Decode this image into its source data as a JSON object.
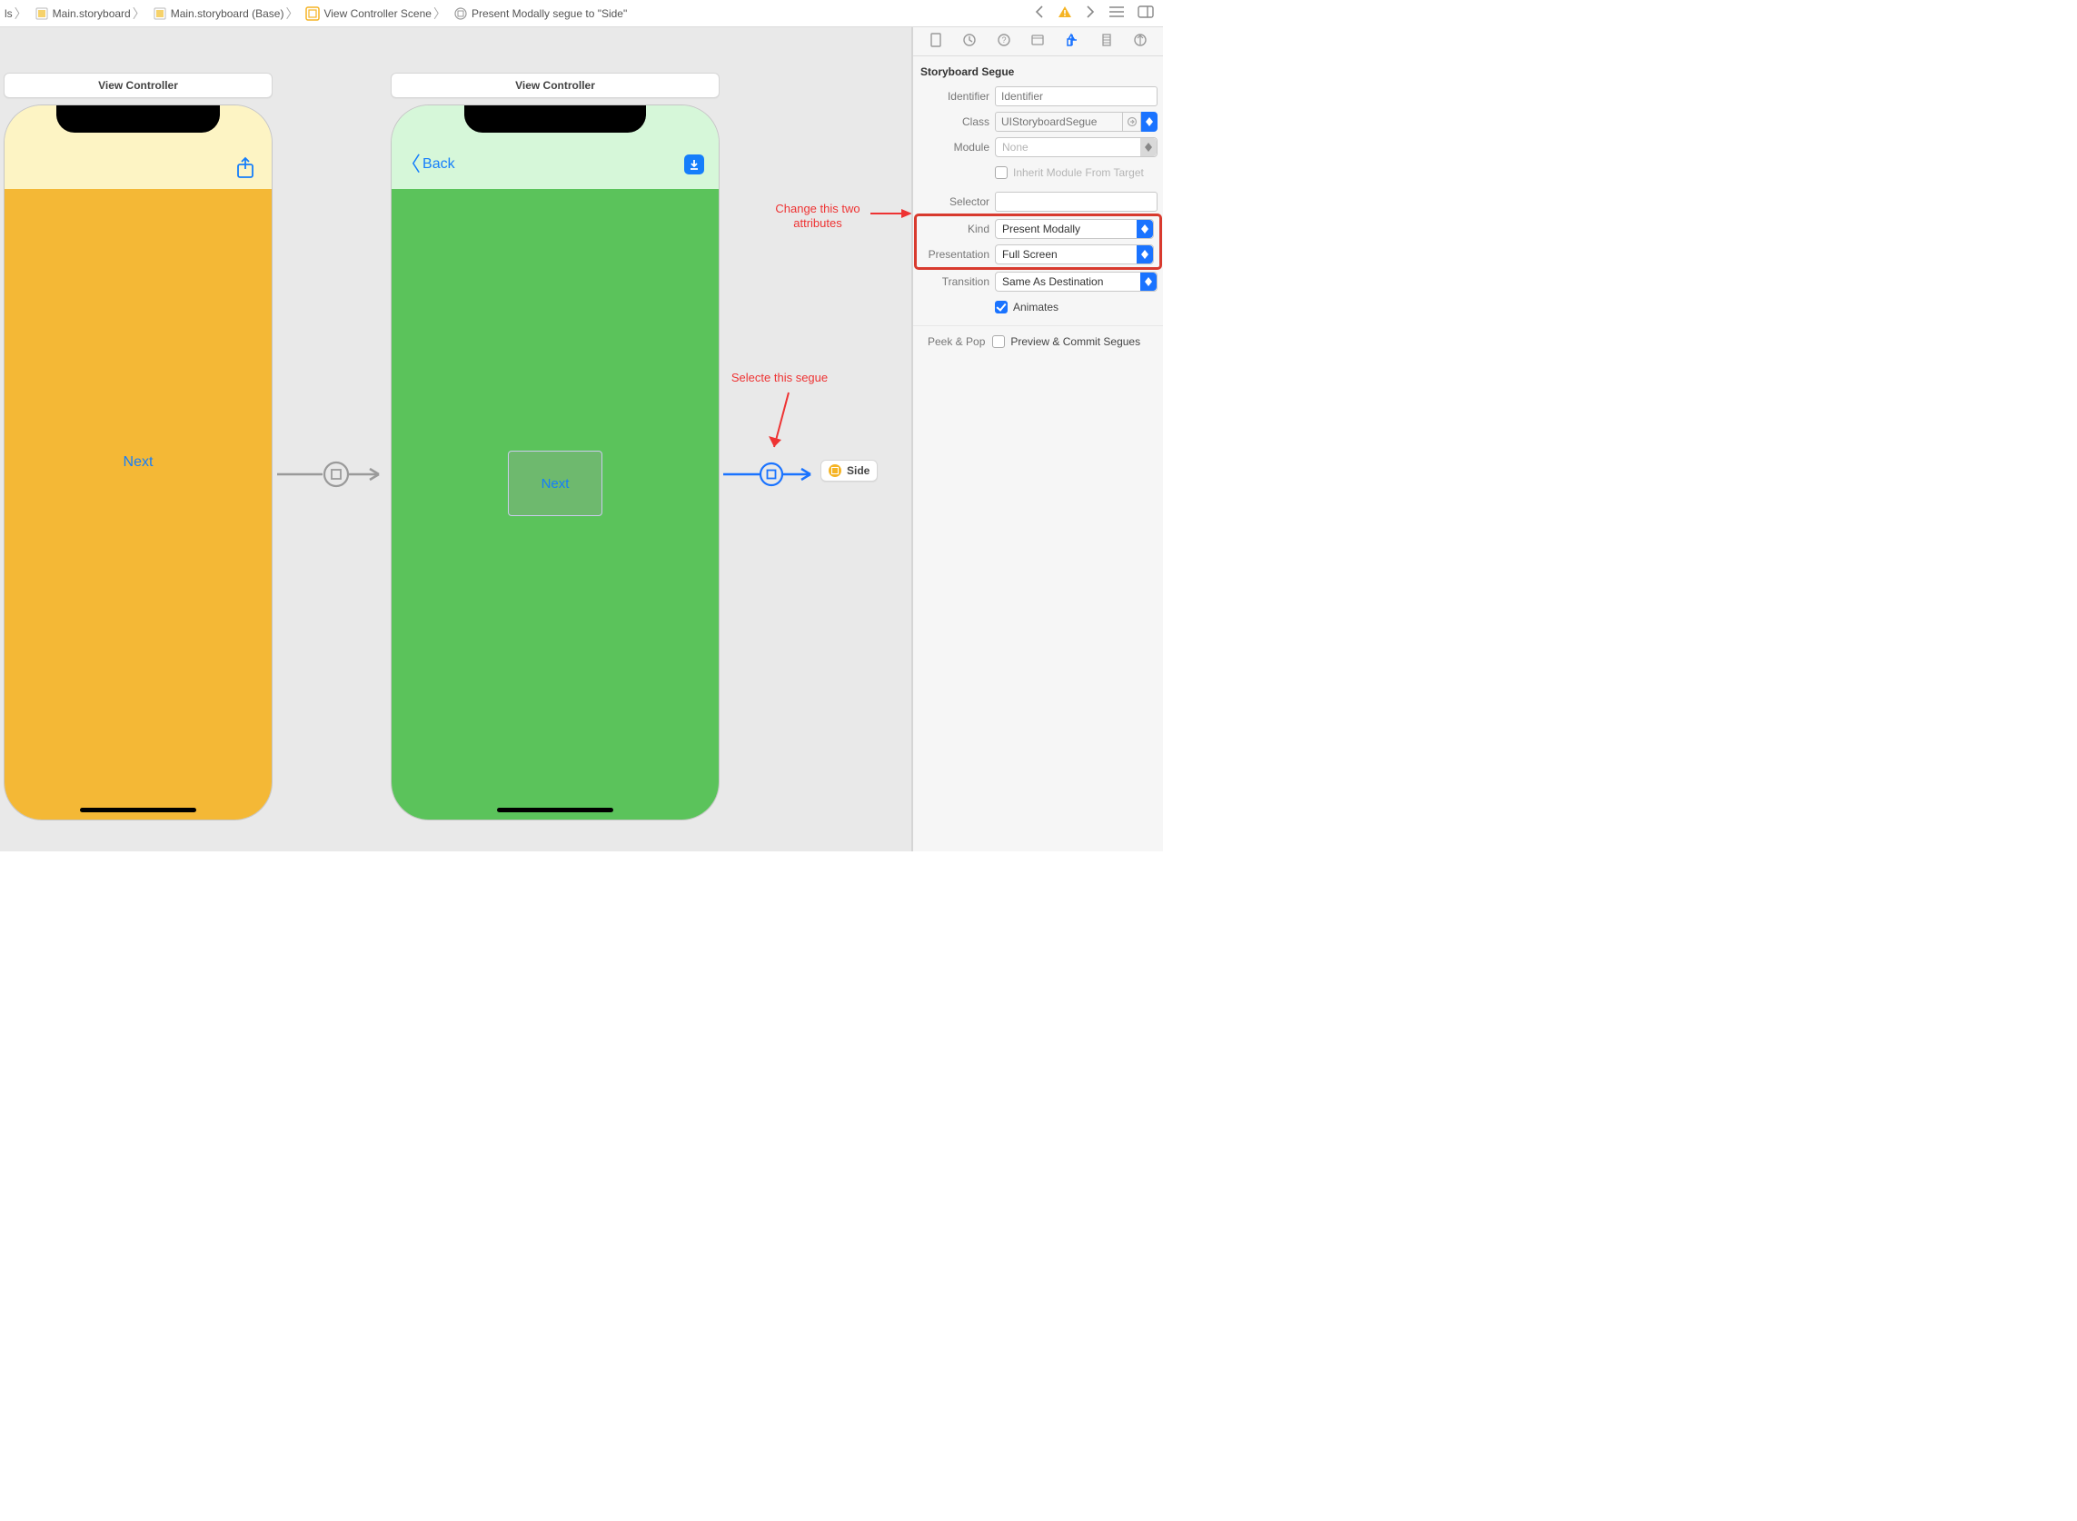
{
  "breadcrumb": {
    "partial": "ls",
    "file": "Main.storyboard",
    "base": "Main.storyboard (Base)",
    "scene": "View Controller Scene",
    "segue": "Present Modally segue to \"Side\""
  },
  "canvas": {
    "vc1": {
      "title": "View Controller",
      "next_label": "Next"
    },
    "vc2": {
      "title": "View Controller",
      "back_label": "Back",
      "next_label": "Next"
    },
    "side_scene_label": "Side"
  },
  "annotations": {
    "select_segue": "Selecte this segue",
    "change_two_1": "Change this two",
    "change_two_2": "attributes"
  },
  "inspector": {
    "section_title": "Storyboard Segue",
    "identifier_label": "Identifier",
    "identifier_placeholder": "Identifier",
    "class_label": "Class",
    "class_placeholder": "UIStoryboardSegue",
    "module_label": "Module",
    "module_value": "None",
    "inherit_label": "Inherit Module From Target",
    "selector_label": "Selector",
    "kind_label": "Kind",
    "kind_value": "Present Modally",
    "presentation_label": "Presentation",
    "presentation_value": "Full Screen",
    "transition_label": "Transition",
    "transition_value": "Same As Destination",
    "animates_label": "Animates",
    "peekpop_label": "Peek & Pop",
    "peekpop_value": "Preview & Commit Segues"
  }
}
